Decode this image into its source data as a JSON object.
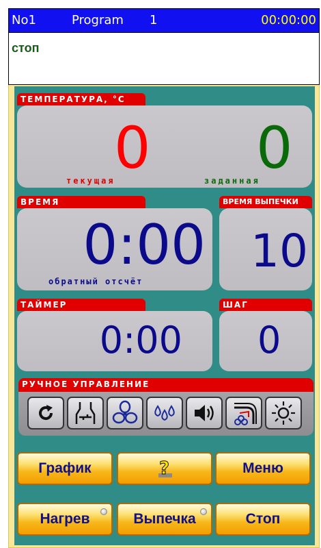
{
  "header": {
    "number": "No1",
    "program_label": "Program",
    "program_number": "1",
    "time": "00:00:00"
  },
  "status": "стоп",
  "temperature": {
    "title": "ТЕМПЕРАТУРА, °С",
    "current_value": "0",
    "current_label": "текущая",
    "set_value": "0",
    "set_label": "заданная"
  },
  "time_section": {
    "title": "ВРЕМЯ",
    "value": "0:00",
    "label": "обратный отсчёт"
  },
  "bake_time": {
    "title": "ВРЕМЯ ВЫПЕЧКИ",
    "value": "10"
  },
  "timer": {
    "title": "ТАЙМЕР",
    "value": "0:00"
  },
  "step": {
    "title": "ШАГ",
    "value": "0"
  },
  "manual": {
    "title": "РУЧНОЕ УПРАВЛЕНИЕ",
    "icons": [
      "rotate-icon",
      "damper-icon",
      "fan-icon",
      "steam-icon",
      "sound-icon",
      "hood-fan-icon",
      "light-icon"
    ]
  },
  "buttons": {
    "chart": "График",
    "menu": "Меню",
    "heat": "Нагрев",
    "bake": "Выпечка",
    "stop": "Стоп"
  },
  "colors": {
    "title_bg": "#1010f0",
    "time_text": "#ffff00",
    "status_text": "#1a5b1a",
    "teal_bg": "#2f8c86",
    "tab_red": "#e00000",
    "current_temp": "#ff0000",
    "set_temp": "#0a6a0a",
    "value_blue": "#0a0a8a"
  }
}
